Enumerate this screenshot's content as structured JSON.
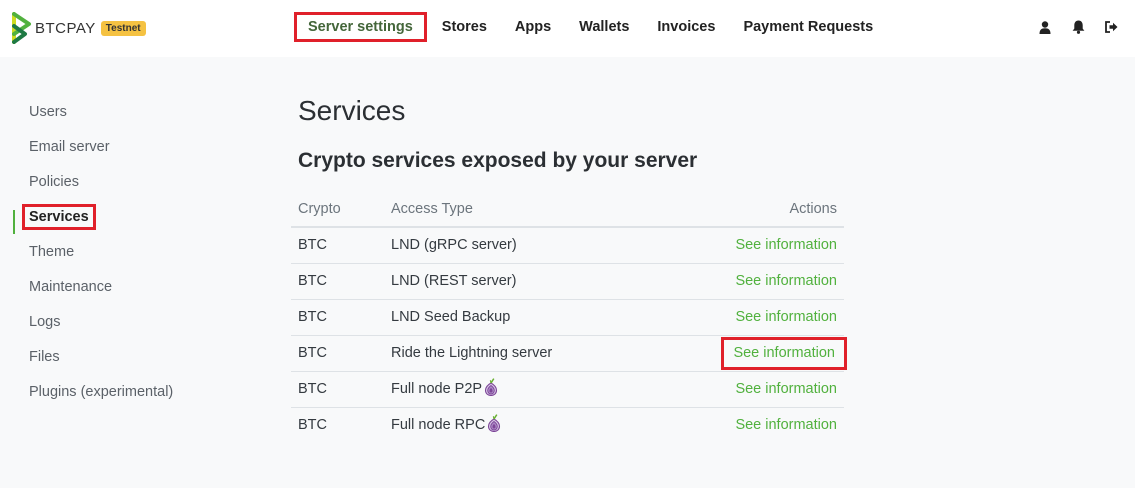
{
  "header": {
    "brand": "BTCPAY",
    "badge": "Testnet",
    "nav": [
      {
        "label": "Server settings",
        "active": true
      },
      {
        "label": "Stores"
      },
      {
        "label": "Apps"
      },
      {
        "label": "Wallets"
      },
      {
        "label": "Invoices"
      },
      {
        "label": "Payment Requests"
      }
    ],
    "icons": [
      "user-icon",
      "bell-icon",
      "logout-icon"
    ]
  },
  "sidebar": {
    "items": [
      {
        "label": "Users"
      },
      {
        "label": "Email server"
      },
      {
        "label": "Policies"
      },
      {
        "label": "Services",
        "active": true
      },
      {
        "label": "Theme"
      },
      {
        "label": "Maintenance"
      },
      {
        "label": "Logs"
      },
      {
        "label": "Files"
      },
      {
        "label": "Plugins (experimental)"
      }
    ]
  },
  "main": {
    "title": "Services",
    "subtitle": "Crypto services exposed by your server",
    "table": {
      "headers": {
        "crypto": "Crypto",
        "access": "Access Type",
        "actions": "Actions"
      },
      "rows": [
        {
          "crypto": "BTC",
          "access": "LND (gRPC server)",
          "action": "See information",
          "tor": false,
          "highlight": false
        },
        {
          "crypto": "BTC",
          "access": "LND (REST server)",
          "action": "See information",
          "tor": false,
          "highlight": false
        },
        {
          "crypto": "BTC",
          "access": "LND Seed Backup",
          "action": "See information",
          "tor": false,
          "highlight": false
        },
        {
          "crypto": "BTC",
          "access": "Ride the Lightning server",
          "action": "See information",
          "tor": false,
          "highlight": true
        },
        {
          "crypto": "BTC",
          "access": "Full node P2P",
          "action": "See information",
          "tor": true,
          "highlight": false
        },
        {
          "crypto": "BTC",
          "access": "Full node RPC",
          "action": "See information",
          "tor": true,
          "highlight": false
        }
      ]
    }
  },
  "colors": {
    "accent": "#51b13e",
    "highlight": "#e0202a",
    "badge": "#f5c242"
  }
}
